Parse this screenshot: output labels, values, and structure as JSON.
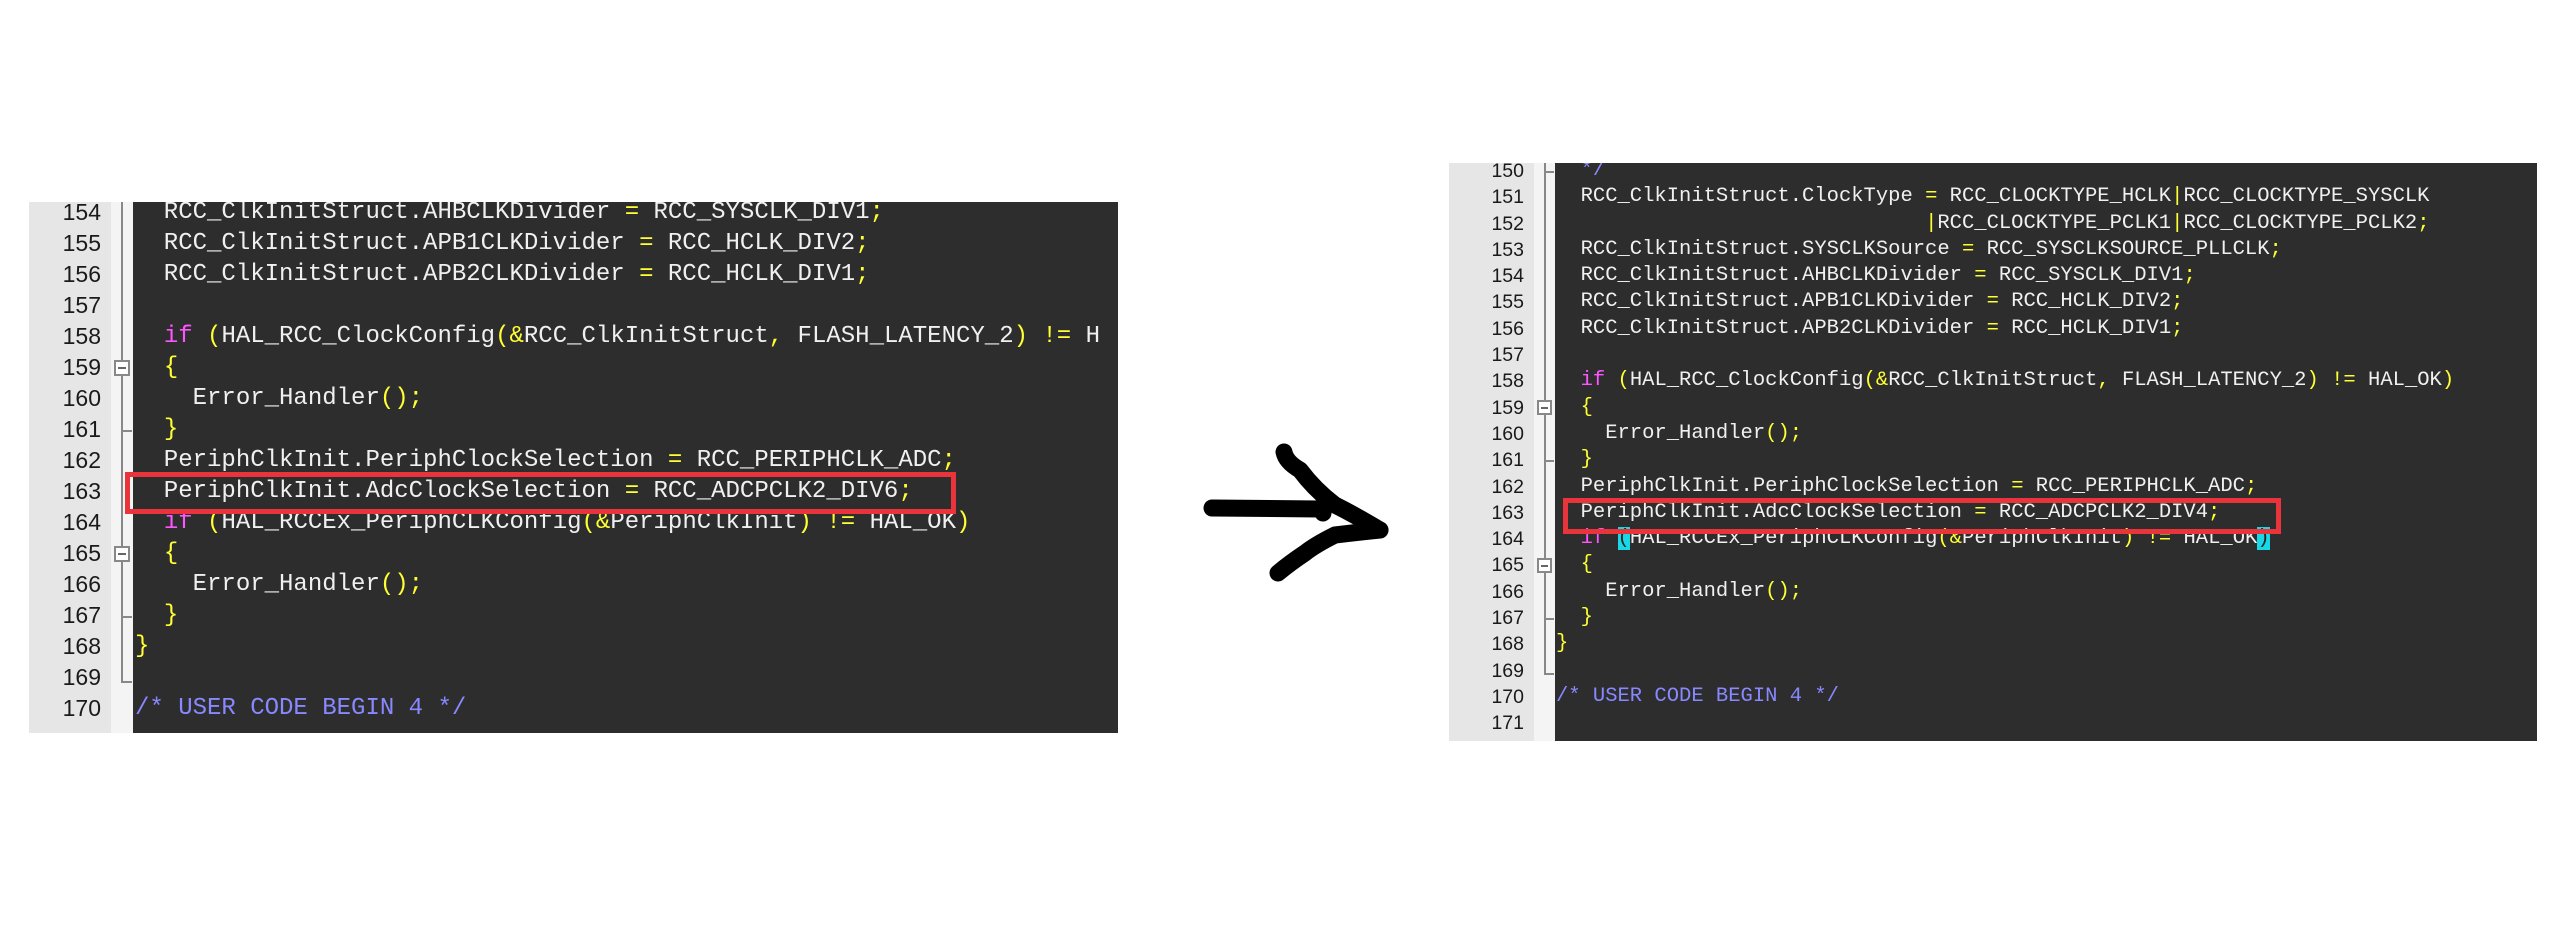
{
  "panels": [
    {
      "id": "before",
      "highlighted_line": 163,
      "lines": [
        {
          "num": "154",
          "fold": "line",
          "tokens": [
            {
              "t": "  RCC_ClkInitStruct.AHBCLKDivider ",
              "c": "id"
            },
            {
              "t": "=",
              "c": "p"
            },
            {
              "t": " RCC_SYSCLK_DIV1",
              "c": "id"
            },
            {
              "t": ";",
              "c": "p"
            }
          ]
        },
        {
          "num": "155",
          "fold": "line",
          "tokens": [
            {
              "t": "  RCC_ClkInitStruct.APB1CLKDivider ",
              "c": "id"
            },
            {
              "t": "=",
              "c": "p"
            },
            {
              "t": " RCC_HCLK_DIV2",
              "c": "id"
            },
            {
              "t": ";",
              "c": "p"
            }
          ]
        },
        {
          "num": "156",
          "fold": "line",
          "tokens": [
            {
              "t": "  RCC_ClkInitStruct.APB2CLKDivider ",
              "c": "id"
            },
            {
              "t": "=",
              "c": "p"
            },
            {
              "t": " RCC_HCLK_DIV1",
              "c": "id"
            },
            {
              "t": ";",
              "c": "p"
            }
          ]
        },
        {
          "num": "157",
          "fold": "line",
          "tokens": []
        },
        {
          "num": "158",
          "fold": "line",
          "tokens": [
            {
              "t": "  ",
              "c": "id"
            },
            {
              "t": "if",
              "c": "kw"
            },
            {
              "t": " ",
              "c": "id"
            },
            {
              "t": "(",
              "c": "p"
            },
            {
              "t": "HAL_RCC_ClockConfig",
              "c": "id"
            },
            {
              "t": "(&",
              "c": "p"
            },
            {
              "t": "RCC_ClkInitStruct",
              "c": "id"
            },
            {
              "t": ",",
              "c": "p"
            },
            {
              "t": " FLASH_LATENCY_2",
              "c": "id"
            },
            {
              "t": ")",
              "c": "p"
            },
            {
              "t": " ",
              "c": "id"
            },
            {
              "t": "!=",
              "c": "p"
            },
            {
              "t": " H",
              "c": "id"
            }
          ]
        },
        {
          "num": "159",
          "fold": "open",
          "tokens": [
            {
              "t": "  ",
              "c": "id"
            },
            {
              "t": "{",
              "c": "p"
            }
          ]
        },
        {
          "num": "160",
          "fold": "line",
          "tokens": [
            {
              "t": "    Error_Handler",
              "c": "id"
            },
            {
              "t": "();",
              "c": "p"
            }
          ]
        },
        {
          "num": "161",
          "fold": "tick",
          "tokens": [
            {
              "t": "  ",
              "c": "id"
            },
            {
              "t": "}",
              "c": "p"
            }
          ]
        },
        {
          "num": "162",
          "fold": "line",
          "tokens": [
            {
              "t": "  PeriphClkInit.PeriphClockSelection ",
              "c": "id"
            },
            {
              "t": "=",
              "c": "p"
            },
            {
              "t": " RCC_PERIPHCLK_ADC",
              "c": "id"
            },
            {
              "t": ";",
              "c": "p"
            }
          ]
        },
        {
          "num": "163",
          "fold": "line",
          "tokens": [
            {
              "t": "  PeriphClkInit.AdcClockSelection ",
              "c": "id"
            },
            {
              "t": "=",
              "c": "p"
            },
            {
              "t": " RCC_ADCPCLK2_DIV6",
              "c": "id"
            },
            {
              "t": ";",
              "c": "p"
            }
          ]
        },
        {
          "num": "164",
          "fold": "line",
          "tokens": [
            {
              "t": "  ",
              "c": "id"
            },
            {
              "t": "if",
              "c": "kw"
            },
            {
              "t": " ",
              "c": "id"
            },
            {
              "t": "(",
              "c": "p"
            },
            {
              "t": "HAL_RCCEx_PeriphCLKConfig",
              "c": "id"
            },
            {
              "t": "(&",
              "c": "p"
            },
            {
              "t": "PeriphClkInit",
              "c": "id"
            },
            {
              "t": ")",
              "c": "p"
            },
            {
              "t": " ",
              "c": "id"
            },
            {
              "t": "!=",
              "c": "p"
            },
            {
              "t": " HAL_OK",
              "c": "id"
            },
            {
              "t": ")",
              "c": "p"
            }
          ]
        },
        {
          "num": "165",
          "fold": "open",
          "tokens": [
            {
              "t": "  ",
              "c": "id"
            },
            {
              "t": "{",
              "c": "p"
            }
          ]
        },
        {
          "num": "166",
          "fold": "line",
          "tokens": [
            {
              "t": "    Error_Handler",
              "c": "id"
            },
            {
              "t": "();",
              "c": "p"
            }
          ]
        },
        {
          "num": "167",
          "fold": "tick",
          "tokens": [
            {
              "t": "  ",
              "c": "id"
            },
            {
              "t": "}",
              "c": "p"
            }
          ]
        },
        {
          "num": "168",
          "fold": "line",
          "tokens": [
            {
              "t": "}",
              "c": "p"
            }
          ]
        },
        {
          "num": "169",
          "fold": "end",
          "tokens": []
        },
        {
          "num": "170",
          "fold": "",
          "tokens": [
            {
              "t": "/* USER CODE BEGIN 4 */",
              "c": "cm"
            }
          ]
        }
      ]
    },
    {
      "id": "after",
      "highlighted_line": 163,
      "lines": [
        {
          "num": "150",
          "fold": "tick",
          "tokens": [
            {
              "t": "  */",
              "c": "cm"
            }
          ]
        },
        {
          "num": "151",
          "fold": "line",
          "tokens": [
            {
              "t": "  RCC_ClkInitStruct.ClockType ",
              "c": "id"
            },
            {
              "t": "=",
              "c": "p"
            },
            {
              "t": " RCC_CLOCKTYPE_HCLK",
              "c": "id"
            },
            {
              "t": "|",
              "c": "p"
            },
            {
              "t": "RCC_CLOCKTYPE_SYSCLK",
              "c": "id"
            }
          ]
        },
        {
          "num": "152",
          "fold": "line",
          "tokens": [
            {
              "t": "                              ",
              "c": "id"
            },
            {
              "t": "|",
              "c": "p"
            },
            {
              "t": "RCC_CLOCKTYPE_PCLK1",
              "c": "id"
            },
            {
              "t": "|",
              "c": "p"
            },
            {
              "t": "RCC_CLOCKTYPE_PCLK2",
              "c": "id"
            },
            {
              "t": ";",
              "c": "p"
            }
          ]
        },
        {
          "num": "153",
          "fold": "line",
          "tokens": [
            {
              "t": "  RCC_ClkInitStruct.SYSCLKSource ",
              "c": "id"
            },
            {
              "t": "=",
              "c": "p"
            },
            {
              "t": " RCC_SYSCLKSOURCE_PLLCLK",
              "c": "id"
            },
            {
              "t": ";",
              "c": "p"
            }
          ]
        },
        {
          "num": "154",
          "fold": "line",
          "tokens": [
            {
              "t": "  RCC_ClkInitStruct.AHBCLKDivider ",
              "c": "id"
            },
            {
              "t": "=",
              "c": "p"
            },
            {
              "t": " RCC_SYSCLK_DIV1",
              "c": "id"
            },
            {
              "t": ";",
              "c": "p"
            }
          ]
        },
        {
          "num": "155",
          "fold": "line",
          "tokens": [
            {
              "t": "  RCC_ClkInitStruct.APB1CLKDivider ",
              "c": "id"
            },
            {
              "t": "=",
              "c": "p"
            },
            {
              "t": " RCC_HCLK_DIV2",
              "c": "id"
            },
            {
              "t": ";",
              "c": "p"
            }
          ]
        },
        {
          "num": "156",
          "fold": "line",
          "tokens": [
            {
              "t": "  RCC_ClkInitStruct.APB2CLKDivider ",
              "c": "id"
            },
            {
              "t": "=",
              "c": "p"
            },
            {
              "t": " RCC_HCLK_DIV1",
              "c": "id"
            },
            {
              "t": ";",
              "c": "p"
            }
          ]
        },
        {
          "num": "157",
          "fold": "line",
          "tokens": []
        },
        {
          "num": "158",
          "fold": "line",
          "tokens": [
            {
              "t": "  ",
              "c": "id"
            },
            {
              "t": "if",
              "c": "kw"
            },
            {
              "t": " ",
              "c": "id"
            },
            {
              "t": "(",
              "c": "p"
            },
            {
              "t": "HAL_RCC_ClockConfig",
              "c": "id"
            },
            {
              "t": "(&",
              "c": "p"
            },
            {
              "t": "RCC_ClkInitStruct",
              "c": "id"
            },
            {
              "t": ",",
              "c": "p"
            },
            {
              "t": " FLASH_LATENCY_2",
              "c": "id"
            },
            {
              "t": ")",
              "c": "p"
            },
            {
              "t": " ",
              "c": "id"
            },
            {
              "t": "!=",
              "c": "p"
            },
            {
              "t": " HAL_OK",
              "c": "id"
            },
            {
              "t": ")",
              "c": "p"
            }
          ]
        },
        {
          "num": "159",
          "fold": "open",
          "tokens": [
            {
              "t": "  ",
              "c": "id"
            },
            {
              "t": "{",
              "c": "p"
            }
          ]
        },
        {
          "num": "160",
          "fold": "line",
          "tokens": [
            {
              "t": "    Error_Handler",
              "c": "id"
            },
            {
              "t": "();",
              "c": "p"
            }
          ]
        },
        {
          "num": "161",
          "fold": "tick",
          "tokens": [
            {
              "t": "  ",
              "c": "id"
            },
            {
              "t": "}",
              "c": "p"
            }
          ]
        },
        {
          "num": "162",
          "fold": "line",
          "tokens": [
            {
              "t": "  PeriphClkInit.PeriphClockSelection ",
              "c": "id"
            },
            {
              "t": "=",
              "c": "p"
            },
            {
              "t": " RCC_PERIPHCLK_ADC",
              "c": "id"
            },
            {
              "t": ";",
              "c": "p"
            }
          ]
        },
        {
          "num": "163",
          "fold": "line",
          "tokens": [
            {
              "t": "  PeriphClkInit.AdcClockSelection ",
              "c": "id"
            },
            {
              "t": "=",
              "c": "p"
            },
            {
              "t": " RCC_ADCPCLK2_DIV4",
              "c": "id"
            },
            {
              "t": ";",
              "c": "p"
            }
          ]
        },
        {
          "num": "164",
          "fold": "line",
          "tokens": [
            {
              "t": "  ",
              "c": "id"
            },
            {
              "t": "if",
              "c": "kw"
            },
            {
              "t": " ",
              "c": "id"
            },
            {
              "t": "(",
              "c": "bm"
            },
            {
              "t": "HAL_RCCEx_PeriphCLKConfig",
              "c": "id"
            },
            {
              "t": "(&",
              "c": "p"
            },
            {
              "t": "PeriphClkInit",
              "c": "id"
            },
            {
              "t": ")",
              "c": "p"
            },
            {
              "t": " ",
              "c": "id"
            },
            {
              "t": "!=",
              "c": "p"
            },
            {
              "t": " HAL_OK",
              "c": "id"
            },
            {
              "t": ")",
              "c": "bm"
            }
          ]
        },
        {
          "num": "165",
          "fold": "open",
          "tokens": [
            {
              "t": "  ",
              "c": "id"
            },
            {
              "t": "{",
              "c": "p"
            }
          ]
        },
        {
          "num": "166",
          "fold": "line",
          "tokens": [
            {
              "t": "    Error_Handler",
              "c": "id"
            },
            {
              "t": "();",
              "c": "p"
            }
          ]
        },
        {
          "num": "167",
          "fold": "tick",
          "tokens": [
            {
              "t": "  ",
              "c": "id"
            },
            {
              "t": "}",
              "c": "p"
            }
          ]
        },
        {
          "num": "168",
          "fold": "line",
          "tokens": [
            {
              "t": "}",
              "c": "p"
            }
          ]
        },
        {
          "num": "169",
          "fold": "end",
          "tokens": []
        },
        {
          "num": "170",
          "fold": "",
          "tokens": [
            {
              "t": "/* USER CODE BEGIN 4 */",
              "c": "cm"
            }
          ]
        },
        {
          "num": "171",
          "fold": "",
          "tokens": []
        }
      ]
    }
  ],
  "colors": {
    "editor_bg": "#2d2d2d",
    "identifier": "#f0f0f0",
    "punctuation": "#ffff33",
    "keyword": "#ff55ff",
    "comment": "#8888ff",
    "brace_match": "#18d8e8",
    "highlight_box": "#e8343a",
    "arrow": "#000000"
  },
  "arrow": {
    "icon": "hand-drawn-right-arrow-icon"
  }
}
